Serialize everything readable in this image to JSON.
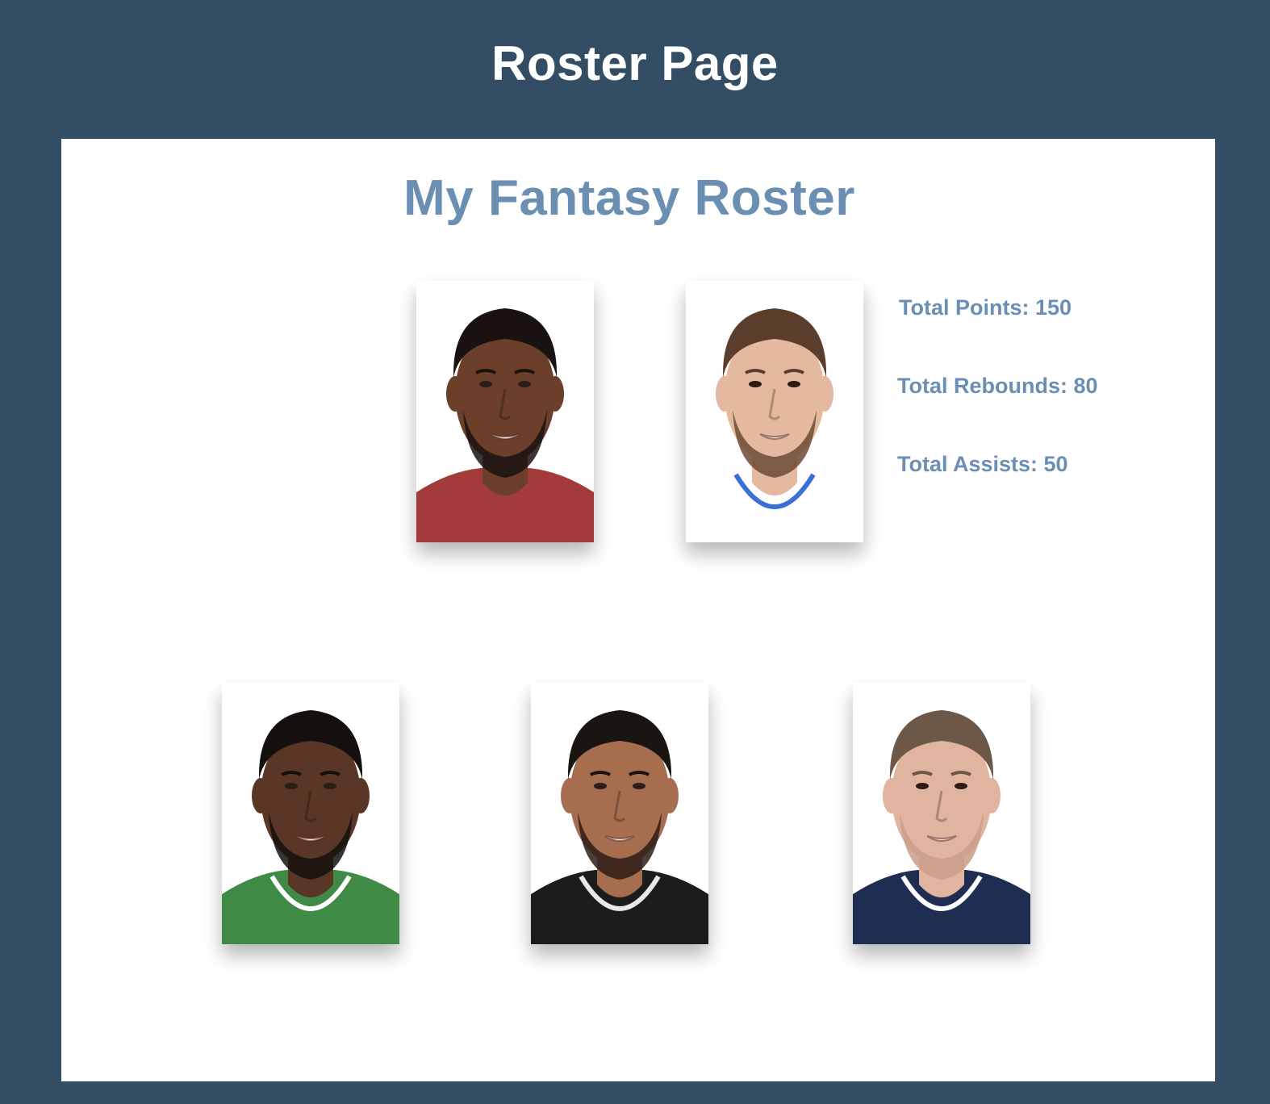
{
  "header": {
    "title": "Roster Page"
  },
  "roster": {
    "title": "My Fantasy Roster",
    "players": [
      {
        "photo": "player-photo-1",
        "skin": "#6b3f2a",
        "hair": "#1a1210",
        "beard": "#1a1210",
        "jersey": "#a33b3a",
        "trim": "#a33b3a"
      },
      {
        "photo": "player-photo-2",
        "skin": "#e4b9a0",
        "hair": "#5a3d2b",
        "beard": "#6b4a35",
        "jersey": "#ffffff",
        "trim": "#3a6fd8"
      },
      {
        "photo": "player-photo-3",
        "skin": "#5a3626",
        "hair": "#15100e",
        "beard": "#15100e",
        "jersey": "#3f8a45",
        "trim": "#ffffff"
      },
      {
        "photo": "player-photo-4",
        "skin": "#a66d4f",
        "hair": "#1b1512",
        "beard": "#2a1d16",
        "jersey": "#1c1c1c",
        "trim": "#e8e8e8"
      },
      {
        "photo": "player-photo-5",
        "skin": "#e0b49e",
        "hair": "#6d5848",
        "beard": "#c99d88",
        "jersey": "#1f2d52",
        "trim": "#ffffff"
      }
    ]
  },
  "stats": {
    "points": "Total Points: 150",
    "rebounds": "Total Rebounds: 80",
    "assists": "Total Assists: 50"
  }
}
